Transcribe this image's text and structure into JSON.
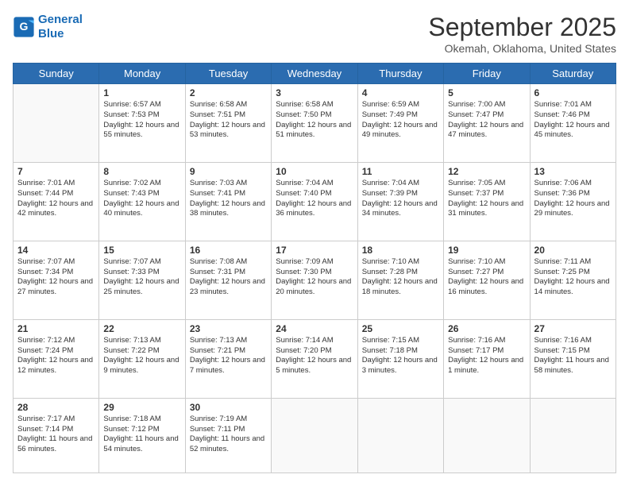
{
  "logo": {
    "line1": "General",
    "line2": "Blue"
  },
  "title": "September 2025",
  "location": "Okemah, Oklahoma, United States",
  "days_of_week": [
    "Sunday",
    "Monday",
    "Tuesday",
    "Wednesday",
    "Thursday",
    "Friday",
    "Saturday"
  ],
  "weeks": [
    [
      {
        "day": "",
        "content": ""
      },
      {
        "day": "1",
        "content": "Sunrise: 6:57 AM\nSunset: 7:53 PM\nDaylight: 12 hours\nand 55 minutes."
      },
      {
        "day": "2",
        "content": "Sunrise: 6:58 AM\nSunset: 7:51 PM\nDaylight: 12 hours\nand 53 minutes."
      },
      {
        "day": "3",
        "content": "Sunrise: 6:58 AM\nSunset: 7:50 PM\nDaylight: 12 hours\nand 51 minutes."
      },
      {
        "day": "4",
        "content": "Sunrise: 6:59 AM\nSunset: 7:49 PM\nDaylight: 12 hours\nand 49 minutes."
      },
      {
        "day": "5",
        "content": "Sunrise: 7:00 AM\nSunset: 7:47 PM\nDaylight: 12 hours\nand 47 minutes."
      },
      {
        "day": "6",
        "content": "Sunrise: 7:01 AM\nSunset: 7:46 PM\nDaylight: 12 hours\nand 45 minutes."
      }
    ],
    [
      {
        "day": "7",
        "content": "Sunrise: 7:01 AM\nSunset: 7:44 PM\nDaylight: 12 hours\nand 42 minutes."
      },
      {
        "day": "8",
        "content": "Sunrise: 7:02 AM\nSunset: 7:43 PM\nDaylight: 12 hours\nand 40 minutes."
      },
      {
        "day": "9",
        "content": "Sunrise: 7:03 AM\nSunset: 7:41 PM\nDaylight: 12 hours\nand 38 minutes."
      },
      {
        "day": "10",
        "content": "Sunrise: 7:04 AM\nSunset: 7:40 PM\nDaylight: 12 hours\nand 36 minutes."
      },
      {
        "day": "11",
        "content": "Sunrise: 7:04 AM\nSunset: 7:39 PM\nDaylight: 12 hours\nand 34 minutes."
      },
      {
        "day": "12",
        "content": "Sunrise: 7:05 AM\nSunset: 7:37 PM\nDaylight: 12 hours\nand 31 minutes."
      },
      {
        "day": "13",
        "content": "Sunrise: 7:06 AM\nSunset: 7:36 PM\nDaylight: 12 hours\nand 29 minutes."
      }
    ],
    [
      {
        "day": "14",
        "content": "Sunrise: 7:07 AM\nSunset: 7:34 PM\nDaylight: 12 hours\nand 27 minutes."
      },
      {
        "day": "15",
        "content": "Sunrise: 7:07 AM\nSunset: 7:33 PM\nDaylight: 12 hours\nand 25 minutes."
      },
      {
        "day": "16",
        "content": "Sunrise: 7:08 AM\nSunset: 7:31 PM\nDaylight: 12 hours\nand 23 minutes."
      },
      {
        "day": "17",
        "content": "Sunrise: 7:09 AM\nSunset: 7:30 PM\nDaylight: 12 hours\nand 20 minutes."
      },
      {
        "day": "18",
        "content": "Sunrise: 7:10 AM\nSunset: 7:28 PM\nDaylight: 12 hours\nand 18 minutes."
      },
      {
        "day": "19",
        "content": "Sunrise: 7:10 AM\nSunset: 7:27 PM\nDaylight: 12 hours\nand 16 minutes."
      },
      {
        "day": "20",
        "content": "Sunrise: 7:11 AM\nSunset: 7:25 PM\nDaylight: 12 hours\nand 14 minutes."
      }
    ],
    [
      {
        "day": "21",
        "content": "Sunrise: 7:12 AM\nSunset: 7:24 PM\nDaylight: 12 hours\nand 12 minutes."
      },
      {
        "day": "22",
        "content": "Sunrise: 7:13 AM\nSunset: 7:22 PM\nDaylight: 12 hours\nand 9 minutes."
      },
      {
        "day": "23",
        "content": "Sunrise: 7:13 AM\nSunset: 7:21 PM\nDaylight: 12 hours\nand 7 minutes."
      },
      {
        "day": "24",
        "content": "Sunrise: 7:14 AM\nSunset: 7:20 PM\nDaylight: 12 hours\nand 5 minutes."
      },
      {
        "day": "25",
        "content": "Sunrise: 7:15 AM\nSunset: 7:18 PM\nDaylight: 12 hours\nand 3 minutes."
      },
      {
        "day": "26",
        "content": "Sunrise: 7:16 AM\nSunset: 7:17 PM\nDaylight: 12 hours\nand 1 minute."
      },
      {
        "day": "27",
        "content": "Sunrise: 7:16 AM\nSunset: 7:15 PM\nDaylight: 11 hours\nand 58 minutes."
      }
    ],
    [
      {
        "day": "28",
        "content": "Sunrise: 7:17 AM\nSunset: 7:14 PM\nDaylight: 11 hours\nand 56 minutes."
      },
      {
        "day": "29",
        "content": "Sunrise: 7:18 AM\nSunset: 7:12 PM\nDaylight: 11 hours\nand 54 minutes."
      },
      {
        "day": "30",
        "content": "Sunrise: 7:19 AM\nSunset: 7:11 PM\nDaylight: 11 hours\nand 52 minutes."
      },
      {
        "day": "",
        "content": ""
      },
      {
        "day": "",
        "content": ""
      },
      {
        "day": "",
        "content": ""
      },
      {
        "day": "",
        "content": ""
      }
    ]
  ]
}
